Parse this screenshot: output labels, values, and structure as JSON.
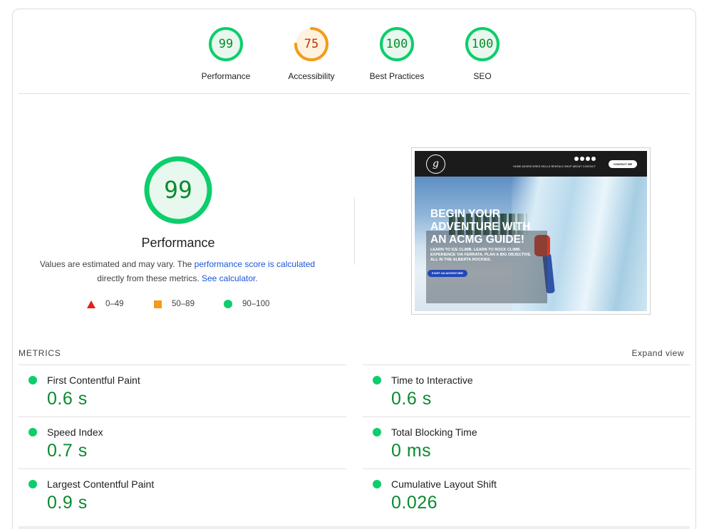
{
  "summary_gauges": [
    {
      "score": "99",
      "label": "Performance",
      "fraction": 0.99,
      "color": "#0cce6b",
      "text_color": "#0b8a2e",
      "fill": "#e8f8ee"
    },
    {
      "score": "75",
      "label": "Accessibility",
      "fraction": 0.75,
      "color": "#f29b1a",
      "text_color": "#c33300",
      "fill": "#fff3e0"
    },
    {
      "score": "100",
      "label": "Best Practices",
      "fraction": 1.0,
      "color": "#0cce6b",
      "text_color": "#0b8a2e",
      "fill": "#e8f8ee"
    },
    {
      "score": "100",
      "label": "SEO",
      "fraction": 1.0,
      "color": "#0cce6b",
      "text_color": "#0b8a2e",
      "fill": "#e8f8ee"
    }
  ],
  "performance": {
    "score": "99",
    "fraction": 0.99,
    "title": "Performance",
    "desc_prefix": "Values are estimated and may vary. The ",
    "desc_link1": "performance score is calculated",
    "desc_mid": " directly from these metrics. ",
    "desc_link2": "See calculator."
  },
  "legend": {
    "fail": "0–49",
    "average": "50–89",
    "pass": "90–100"
  },
  "screenshot": {
    "contact_button": "CONTACT ME",
    "nav_links": "HOME  ADVENTURES  SKILLS  RENTALS  SHOP  ABOUT  CONTACT",
    "logo_glyph": "g",
    "headline_1": "BEGIN YOUR",
    "headline_2": "ADVENTURE WITH",
    "headline_3": "AN ACMG GUIDE!",
    "sub_1": "LEARN TO ICE CLIMB. LEARN TO ROCK CLIMB.",
    "sub_2": "EXPERIENCE VIA FERRATA. PLAN A BIG OBJECTIVE.",
    "sub_3": "ALL IN THE ALBERTA ROCKIES.",
    "cta": "START AN ADVENTURE!"
  },
  "metrics": {
    "heading": "METRICS",
    "expand": "Expand view",
    "left": [
      {
        "label": "First Contentful Paint",
        "value": "0.6 s"
      },
      {
        "label": "Speed Index",
        "value": "0.7 s"
      },
      {
        "label": "Largest Contentful Paint",
        "value": "0.9 s"
      }
    ],
    "right": [
      {
        "label": "Time to Interactive",
        "value": "0.6 s"
      },
      {
        "label": "Total Blocking Time",
        "value": "0 ms"
      },
      {
        "label": "Cumulative Layout Shift",
        "value": "0.026"
      }
    ]
  }
}
